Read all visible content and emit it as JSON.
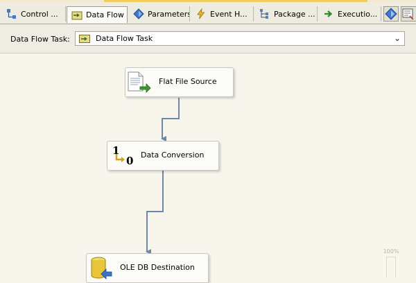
{
  "tabs": [
    {
      "label": "Control ...",
      "icon": "control-flow-icon",
      "active": false
    },
    {
      "label": "Data Flow",
      "icon": "data-flow-icon",
      "active": true
    },
    {
      "label": "Parameters",
      "icon": "parameters-icon",
      "active": false
    },
    {
      "label": "Event H...",
      "icon": "event-handlers-icon",
      "active": false
    },
    {
      "label": "Package ...",
      "icon": "package-explorer-icon",
      "active": false
    },
    {
      "label": "Executio...",
      "icon": "execution-results-icon",
      "active": false
    }
  ],
  "task": {
    "label": "Data Flow Task:",
    "selected": "Data Flow Task"
  },
  "nodes": [
    {
      "label": "Flat File Source",
      "icon": "flat-file-source-icon"
    },
    {
      "label": "Data Conversion",
      "icon": "data-conversion-icon"
    },
    {
      "label": "OLE DB Destination",
      "icon": "ole-db-destination-icon"
    }
  ],
  "conversion_icon": {
    "top": "1",
    "bottom": "0"
  },
  "zoom_label": "100%",
  "colors": {
    "canvas": "#f7f5ec",
    "connector": "#6f86a6",
    "active_tab": "#fbfaf5"
  }
}
